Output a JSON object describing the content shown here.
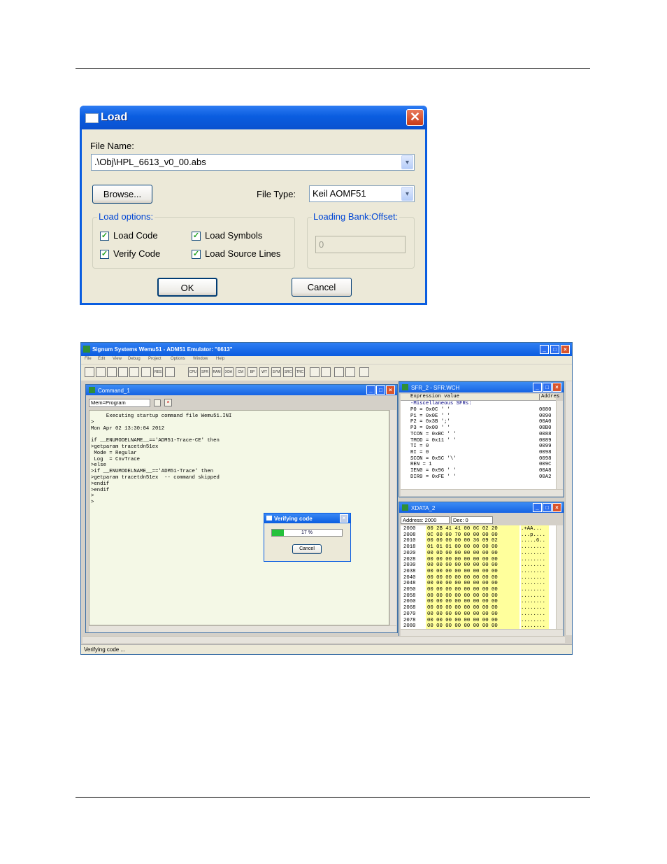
{
  "load_dialog": {
    "title": "Load",
    "close_glyph": "✕",
    "file_name_label": "File Name:",
    "file_name_value": ".\\Obj\\HPL_6613_v0_00.abs",
    "browse_label": "Browse...",
    "file_type_label": "File Type:",
    "file_type_value": "Keil AOMF51",
    "load_options_label": "Load options:",
    "options": [
      {
        "label": "Load Code",
        "checked": true
      },
      {
        "label": "Load Symbols",
        "checked": true
      },
      {
        "label": "Verify Code",
        "checked": true
      },
      {
        "label": "Load Source Lines",
        "checked": true
      }
    ],
    "bank_offset_label": "Loading Bank:Offset:",
    "bank_offset_value": "0",
    "ok_label": "OK",
    "cancel_label": "Cancel",
    "check_glyph": "✓",
    "arrow_glyph": "▾"
  },
  "emulator": {
    "title": "Signum Systems Wemu51 - ADM51 Emulator: \"6613\"",
    "menu": [
      "File",
      "Edit",
      "View",
      "Debug",
      "Project",
      "Options",
      "Window",
      "Help"
    ],
    "toolbar_buttons": [
      "",
      "",
      "",
      "",
      "",
      "",
      "RES",
      "",
      "CPU",
      "SFR",
      "RAM",
      "XDA",
      "CM",
      "BP",
      "WT",
      "SYM",
      "SRC",
      "TRC",
      "",
      "",
      "",
      "",
      ""
    ],
    "command_window": {
      "title": "Command_1",
      "mem_select": "Mem=Program",
      "lines": [
        "     Executing startup command file Wemu51.INI",
        ">",
        "Mon Apr 02 13:30:04 2012",
        "",
        "if __ENUMODELNAME__=='ADM51-Trace-CE' then",
        ">getparam tracetdn51ex",
        " Mode = Regular",
        " Log  = CnvTrace",
        ">else",
        ">if __ENUMODELNAME__=='ADM51-Trace' then",
        ">getparam tracetdn51ex  -- command skipped",
        ">endif",
        ">endif",
        ">",
        ">"
      ]
    },
    "verify_dialog": {
      "title": "Verifying code",
      "progress_text": "17 %",
      "progress_fraction": 0.17,
      "cancel_label": "Cancel"
    },
    "sfr_window": {
      "title": "SFR_2 - SFR.WCH",
      "col_expr": "Expression value",
      "col_addr": "Addres",
      "group_label": "-Miscellaneous SFRs:",
      "rows": [
        {
          "expr": "P0 = 0x0C ' '",
          "addr": "0080"
        },
        {
          "expr": "P1 = 0x0E ' '",
          "addr": "0090"
        },
        {
          "expr": "P2 = 0x3B ';'",
          "addr": "00A0"
        },
        {
          "expr": "P3 = 0x00 ' '",
          "addr": "00B0"
        },
        {
          "expr": "TCON = 0xBC ' '",
          "addr": "0088"
        },
        {
          "expr": "TMOD = 0x11 ' '",
          "addr": "0089"
        },
        {
          "expr": "TI = 0",
          "addr": "0099"
        },
        {
          "expr": "RI = 0",
          "addr": "0098"
        },
        {
          "expr": "SCON = 0x5C '\\'",
          "addr": "0098"
        },
        {
          "expr": "REN = 1",
          "addr": "009C"
        },
        {
          "expr": "IEN0 = 0x96 ' '",
          "addr": "00A8"
        },
        {
          "expr": "DIR0 = 0xFE ' '",
          "addr": "00A2"
        }
      ]
    },
    "xdata_window": {
      "title": "XDATA_2",
      "address_label": "Address: 2000",
      "dec_label": "Dec:  0",
      "rows": [
        {
          "addr": "2000",
          "hex": "00 2B 41 41 00 0C 02 20",
          "ascii": ".+AA... "
        },
        {
          "addr": "2008",
          "hex": "0C 00 00 70 00 00 00 00",
          "ascii": "...p...."
        },
        {
          "addr": "2010",
          "hex": "00 00 00 00 00 36 09 02",
          "ascii": ".....6.."
        },
        {
          "addr": "2018",
          "hex": "01 01 01 00 00 00 00 00",
          "ascii": "........"
        },
        {
          "addr": "2020",
          "hex": "00 0D 00 00 00 00 00 00",
          "ascii": "........"
        },
        {
          "addr": "2028",
          "hex": "00 00 00 00 00 00 00 00",
          "ascii": "........"
        },
        {
          "addr": "2030",
          "hex": "00 00 00 00 00 00 00 00",
          "ascii": "........"
        },
        {
          "addr": "2038",
          "hex": "00 00 00 00 00 00 00 00",
          "ascii": "........"
        },
        {
          "addr": "2040",
          "hex": "00 00 00 00 00 00 00 00",
          "ascii": "........"
        },
        {
          "addr": "2048",
          "hex": "00 00 00 00 00 00 00 00",
          "ascii": "........"
        },
        {
          "addr": "2050",
          "hex": "00 00 00 00 00 00 00 00",
          "ascii": "........"
        },
        {
          "addr": "2058",
          "hex": "00 00 00 00 00 00 00 00",
          "ascii": "........"
        },
        {
          "addr": "2060",
          "hex": "00 00 00 00 00 00 00 00",
          "ascii": "........"
        },
        {
          "addr": "2068",
          "hex": "00 00 00 00 00 00 00 00",
          "ascii": "........"
        },
        {
          "addr": "2070",
          "hex": "00 00 00 00 00 00 00 00",
          "ascii": "........"
        },
        {
          "addr": "2078",
          "hex": "00 00 00 00 00 00 00 00",
          "ascii": "........"
        },
        {
          "addr": "2080",
          "hex": "00 00 00 00 00 00 00 00",
          "ascii": "........"
        }
      ]
    },
    "status_text": "Verifying code ..."
  },
  "colors": {
    "xp_blue": "#0a5de0",
    "dialog_bg": "#ece9d8",
    "cmd_bg": "#f4f8e6",
    "xdata_hex_bg": "#ffff9c",
    "progress_green": "#25c13b"
  }
}
